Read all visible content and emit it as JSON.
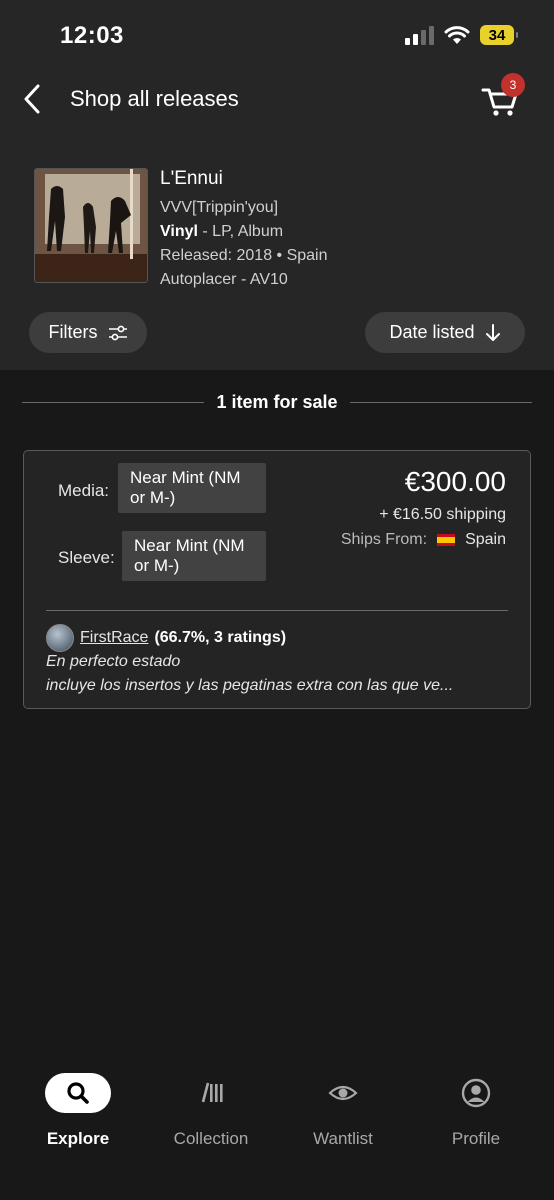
{
  "status_bar": {
    "time": "12:03",
    "battery": "34"
  },
  "header": {
    "title": "Shop all releases",
    "cart_count": "3"
  },
  "release": {
    "title": "L'Ennui",
    "artist": "VVV[Trippin'you]",
    "format_bold": "Vinyl",
    "format_rest": " - LP, Album",
    "released": "Released: 2018 • Spain",
    "label": "Autoplacer - AV10"
  },
  "controls": {
    "filters_label": "Filters",
    "sort_label": "Date listed"
  },
  "listings": {
    "count_text": "1 item for sale",
    "items": [
      {
        "media_label": "Media:",
        "media_value": "Near Mint (NM or M-)",
        "sleeve_label": "Sleeve:",
        "sleeve_value": "Near Mint (NM or M-)",
        "price": "€300.00",
        "shipping": "+ €16.50 shipping",
        "ships_from_label": "Ships From:",
        "ships_from_country": "Spain",
        "seller_name": "FirstRace",
        "seller_rating": "(66.7%, 3 ratings)",
        "comment_line1": "En perfecto estado",
        "comment_line2": "incluye los insertos y las pegatinas extra con las que ve..."
      }
    ]
  },
  "tabbar": {
    "tabs": [
      {
        "label": "Explore",
        "icon": "search-icon",
        "active": true
      },
      {
        "label": "Collection",
        "icon": "collection-icon",
        "active": false
      },
      {
        "label": "Wantlist",
        "icon": "eye-icon",
        "active": false
      },
      {
        "label": "Profile",
        "icon": "profile-icon",
        "active": false
      }
    ]
  },
  "colors": {
    "background": "#181818",
    "header_bg": "#262626",
    "pill_bg": "#3d3d3d",
    "badge": "#c2312b",
    "battery": "#e8d12a"
  }
}
